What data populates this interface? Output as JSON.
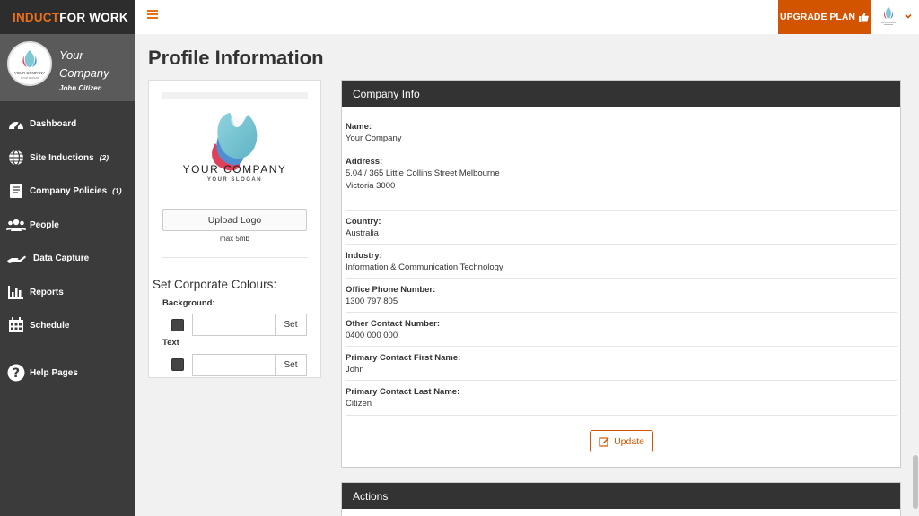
{
  "brand": {
    "part1": "INDUCT",
    "part2": "FOR WORK"
  },
  "profile": {
    "company": "Your Company",
    "user": "John Citizen",
    "avatar_name": "YOUR COMPANY",
    "avatar_slogan": "YOUR SLOGAN"
  },
  "nav": [
    {
      "label": "Dashboard",
      "icon": "dashboard-gauge-icon",
      "count": ""
    },
    {
      "label": "Site Inductions",
      "icon": "globe-icon",
      "count": "(2)"
    },
    {
      "label": "Company Policies",
      "icon": "book-icon",
      "count": "(1)"
    },
    {
      "label": "People",
      "icon": "people-icon",
      "count": ""
    },
    {
      "label": "Data Capture",
      "icon": "hand-icon",
      "count": ""
    },
    {
      "label": "Reports",
      "icon": "bar-chart-icon",
      "count": ""
    },
    {
      "label": "Schedule",
      "icon": "calendar-icon",
      "count": ""
    },
    {
      "label": "Help Pages",
      "icon": "question-circle-icon",
      "count": ""
    }
  ],
  "topbar": {
    "upgrade_label": "UPGRADE PLAN"
  },
  "page": {
    "title": "Profile Information"
  },
  "logo_panel": {
    "logo_name": "YOUR COMPANY",
    "logo_slogan": "YOUR SLOGAN",
    "upload_label": "Upload Logo",
    "max_size": "max 5mb",
    "colours_title": "Set Corporate Colours:",
    "background_label": "Background:",
    "text_label": "Text",
    "set_label": "Set",
    "background_value": "",
    "text_value": ""
  },
  "company_info": {
    "header": "Company Info",
    "fields": [
      {
        "label": "Name:",
        "value": "Your Company"
      },
      {
        "label": "Address:",
        "value": "5.04 / 365 Little Collins Street Melbourne",
        "value2": "Victoria 3000"
      },
      {
        "label": "Country:",
        "value": "Australia"
      },
      {
        "label": "Industry:",
        "value": "Information & Communication Technology"
      },
      {
        "label": "Office Phone Number:",
        "value": "1300 797 805"
      },
      {
        "label": "Other Contact Number:",
        "value": "0400 000 000"
      },
      {
        "label": "Primary Contact First Name:",
        "value": "John"
      },
      {
        "label": "Primary Contact Last Name:",
        "value": "Citizen"
      }
    ],
    "update_label": "Update"
  },
  "actions": {
    "header": "Actions"
  },
  "colors": {
    "accent": "#d35400",
    "sidebar": "#3b3b3b",
    "header_dark": "#333333"
  }
}
